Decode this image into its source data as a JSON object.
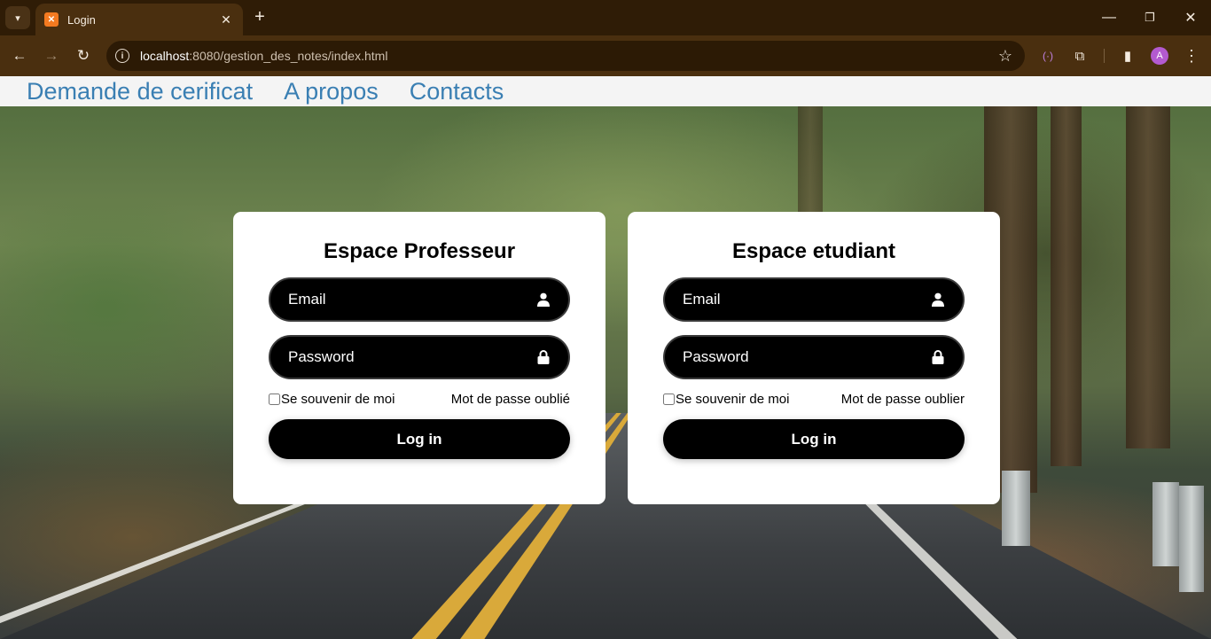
{
  "browser": {
    "tab_title": "Login",
    "url_host": "localhost",
    "url_rest": ":8080/gestion_des_notes/index.html",
    "new_tab_symbol": "+",
    "profile_initial": "A",
    "icons": {
      "tab_search": "chevron-down-icon",
      "favicon": "xampp-icon",
      "back": "arrow-left-icon",
      "forward": "arrow-right-icon",
      "reload": "reload-icon",
      "site_info": "info-icon",
      "bookmark": "star-icon",
      "extension": "puzzle-icon",
      "side_panel": "side-panel-icon",
      "menu": "kebab-menu-icon"
    },
    "accent_colors": {
      "chrome_bg": "#4a2f0f",
      "avatar": "#b35ad0"
    }
  },
  "nav": {
    "items": [
      "Demande de cerificat",
      "A propos",
      "Contacts"
    ],
    "color": "#3a7fb3"
  },
  "professor": {
    "title": "Espace Professeur",
    "email_placeholder": "Email",
    "password_placeholder": "Password",
    "remember_label": "Se souvenir de moi",
    "forgot_label": "Mot de passe oublié",
    "login_label": "Log in"
  },
  "student": {
    "title": "Espace etudiant",
    "email_placeholder": "Email",
    "password_placeholder": "Password",
    "remember_label": "Se souvenir de moi",
    "forgot_label": "Mot de passe oublier",
    "login_label": "Log in"
  }
}
